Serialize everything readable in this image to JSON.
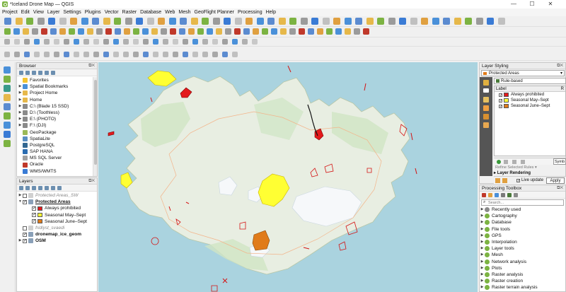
{
  "window": {
    "title": "*Iceland Drone Map — QGIS",
    "controls": {
      "minimize": "—",
      "maximize": "☐",
      "close": "✕"
    }
  },
  "menu": [
    "Project",
    "Edit",
    "View",
    "Layer",
    "Settings",
    "Plugins",
    "Vector",
    "Raster",
    "Database",
    "Web",
    "Mesh",
    "GeoFlight Planner",
    "Processing",
    "Help"
  ],
  "browser": {
    "title": "Browser",
    "items": [
      {
        "label": "Favorites",
        "icon": "star-icon",
        "color": "#f4c430",
        "expand": ""
      },
      {
        "label": "Spatial Bookmarks",
        "icon": "bookmark-icon",
        "color": "#4a90d9",
        "expand": "▶"
      },
      {
        "label": "Project Home",
        "icon": "folder-icon",
        "color": "#e6b84a",
        "expand": "▶"
      },
      {
        "label": "Home",
        "icon": "folder-icon",
        "color": "#e6b84a",
        "expand": "▶"
      },
      {
        "label": "C:\\ (Blade 15 SSD)",
        "icon": "drive-icon",
        "color": "#8a8a8a",
        "expand": "▶"
      },
      {
        "label": "D:\\ (Toothless)",
        "icon": "drive-icon",
        "color": "#8a8a8a",
        "expand": "▶"
      },
      {
        "label": "E:\\ (PHOTO)",
        "icon": "drive-icon",
        "color": "#8a8a8a",
        "expand": "▶"
      },
      {
        "label": "F:\\ (DJI)",
        "icon": "drive-icon",
        "color": "#8a8a8a",
        "expand": "▶"
      },
      {
        "label": "GeoPackage",
        "icon": "geopackage-icon",
        "color": "#9bb957",
        "expand": ""
      },
      {
        "label": "SpatiaLite",
        "icon": "spatialite-icon",
        "color": "#5a8fc2",
        "expand": ""
      },
      {
        "label": "PostgreSQL",
        "icon": "elephant-icon",
        "color": "#336791",
        "expand": ""
      },
      {
        "label": "SAP HANA",
        "icon": "database-icon",
        "color": "#2b6cb0",
        "expand": ""
      },
      {
        "label": "MS SQL Server",
        "icon": "database-icon",
        "color": "#a0a0a0",
        "expand": ""
      },
      {
        "label": "Oracle",
        "icon": "database-icon",
        "color": "#c0392b",
        "expand": ""
      },
      {
        "label": "WMS/WMTS",
        "icon": "globe-icon",
        "color": "#3a7bd5",
        "expand": ""
      }
    ]
  },
  "layers": {
    "title": "Layers",
    "items": [
      {
        "label": "Protected Areas_SW",
        "style": "italic-gray",
        "expand": "▶",
        "checked": "",
        "indent": 0,
        "swatch": ""
      },
      {
        "label": "Protected Areas",
        "style": "bold-underline",
        "expand": "▼",
        "checked": "✓",
        "indent": 0,
        "swatch": ""
      },
      {
        "label": "Always prohibited",
        "style": "normal",
        "expand": "",
        "checked": "✓",
        "indent": 1,
        "swatch": "#e31a1c"
      },
      {
        "label": "Seasonal May–Sept",
        "style": "normal",
        "expand": "",
        "checked": "✓",
        "indent": 1,
        "swatch": "#ffff33"
      },
      {
        "label": "Seasonal June–Sept",
        "style": "normal",
        "expand": "",
        "checked": "✓",
        "indent": 1,
        "swatch": "#e07b1a"
      },
      {
        "label": "fridlyst_svaedi",
        "style": "italic-gray",
        "expand": "",
        "checked": "",
        "indent": 0,
        "swatch": ""
      },
      {
        "label": "dronemap_ice_geom",
        "style": "bold",
        "expand": "",
        "checked": "✓",
        "indent": 0,
        "swatch": ""
      },
      {
        "label": "OSM",
        "style": "bold",
        "expand": "▶",
        "checked": "✓",
        "indent": 0,
        "swatch": ""
      }
    ]
  },
  "styling": {
    "title": "Layer Styling",
    "layer_select": "Protected Areas",
    "renderer": "Rule-based",
    "label_header": "Label",
    "rules": [
      {
        "label": "Always prohibited",
        "color": "#e31a1c"
      },
      {
        "label": "Seasonal May–Sept",
        "color": "#ffff33"
      },
      {
        "label": "Seasonal June–Sept",
        "color": "#e07b1a"
      }
    ],
    "refine_label": "Refine Selected Rules",
    "layer_rendering": "Layer Rendering",
    "live_update": "Live update",
    "apply": "Apply",
    "symbol_button": "Symb"
  },
  "toolbox": {
    "title": "Processing Toolbox",
    "search_placeholder": "Search...",
    "items": [
      "Recently used",
      "Cartography",
      "Database",
      "File tools",
      "GPS",
      "Interpolation",
      "Layer tools",
      "Mesh",
      "Network analysis",
      "Plots",
      "Raster analysis",
      "Raster creation",
      "Raster terrain analysis"
    ]
  }
}
